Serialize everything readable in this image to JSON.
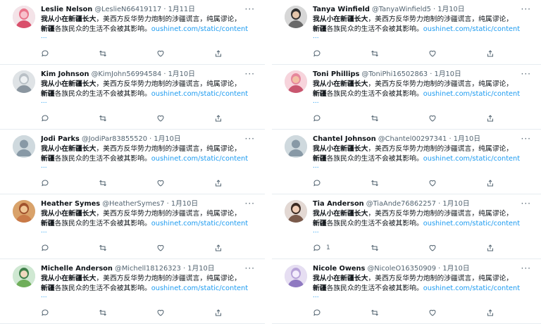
{
  "tweets_left": [
    {
      "name": "Leslie Nelson",
      "handle": "@LeslieN66419117",
      "date": "· 1月11日",
      "avatar": "flowers",
      "replies": ""
    },
    {
      "name": "Kim Johnson",
      "handle": "@KimJohn56994584",
      "date": "· 1月10日",
      "avatar": "photo-grey",
      "replies": ""
    },
    {
      "name": "Jodi Parks",
      "handle": "@JodiPar83855520",
      "date": "· 1月10日",
      "avatar": "default",
      "replies": ""
    },
    {
      "name": "Heather Symes",
      "handle": "@HeatherSymes7",
      "date": "· 1月10日",
      "avatar": "photo-warm",
      "replies": ""
    },
    {
      "name": "Michelle Anderson",
      "handle": "@Michell18126323",
      "date": "· 1月10日",
      "avatar": "photo-green",
      "replies": ""
    }
  ],
  "tweets_right": [
    {
      "name": "Tanya Winfield",
      "handle": "@TanyaWinfield5",
      "date": "· 1月10日",
      "avatar": "photo-dark",
      "replies": ""
    },
    {
      "name": "Toni Phillips",
      "handle": "@ToniPhi16502863",
      "date": "· 1月10日",
      "avatar": "photo-pink",
      "replies": ""
    },
    {
      "name": "Chantel Johnson",
      "handle": "@Chantel00297341",
      "date": "· 1月10日",
      "avatar": "default",
      "replies": ""
    },
    {
      "name": "Tia Anderson",
      "handle": "@TiaAnde76862257",
      "date": "· 1月10日",
      "avatar": "photo-woman",
      "replies": "1"
    },
    {
      "name": "Nicole Owens",
      "handle": "@NicoleO16350909",
      "date": "· 1月10日",
      "avatar": "photo-lilac",
      "replies": ""
    }
  ],
  "text": {
    "bold1": "我从小在新疆长大",
    "mid1": "，美西方反华势力炮制的涉疆谎言，纯属谬论，",
    "bold2": "新疆",
    "mid2": "各族民众的生活不会被其影响。",
    "link": "oushinet.com/static/content",
    "ellipsis": "..."
  },
  "ui": {
    "more": "···"
  },
  "colors": {
    "link": "#1d9bf0",
    "muted": "#536471",
    "divider": "#e6ecf0"
  }
}
